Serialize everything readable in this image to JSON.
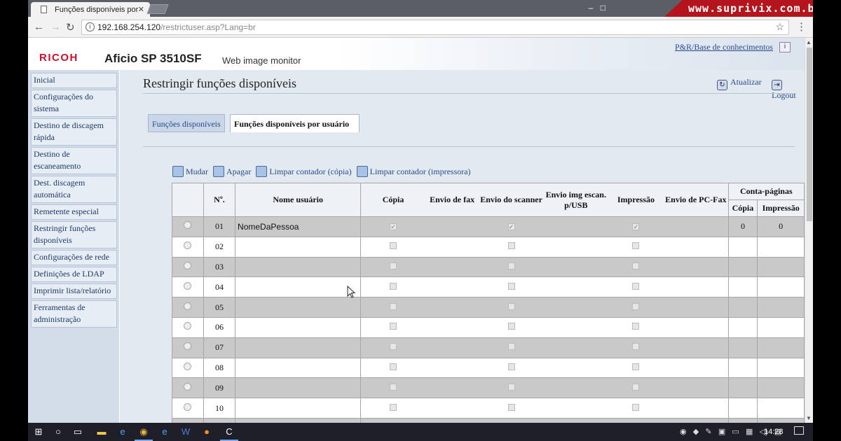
{
  "browser": {
    "tab_title": "Funções disponíveis por",
    "url_host": "192.168.254.120",
    "url_path": "/restrictuser.asp?Lang=br",
    "brand_overlay": "www.suprivix.com.br"
  },
  "header": {
    "logo": "RICOH",
    "model": "Aficio SP 3510SF",
    "subtitle": "Web image monitor",
    "kb_link": "P&R/Base de conhecimentos"
  },
  "sidebar": {
    "items": [
      {
        "label": "Inicial"
      },
      {
        "label": "Configurações do sistema"
      },
      {
        "label": "Destino de discagem rápida"
      },
      {
        "label": "Destino de escaneamento"
      },
      {
        "label": "Dest. discagem automática"
      },
      {
        "label": "Remetente especial"
      },
      {
        "label": "Restringir funções disponíveis"
      },
      {
        "label": "Configurações de rede"
      },
      {
        "label": "Definições de LDAP"
      },
      {
        "label": "Imprimir lista/relatório"
      },
      {
        "label": "Ferramentas de administração"
      }
    ]
  },
  "main": {
    "title": "Restringir funções disponíveis",
    "refresh_label": "Atualizar",
    "logout_label": "Logout",
    "tabs": [
      {
        "label": "Funções disponíveis"
      },
      {
        "label": "Funções disponíveis por usuário"
      }
    ],
    "actions": {
      "change": "Mudar",
      "delete": "Apagar",
      "clear_copy": "Limpar contador (cópia)",
      "clear_print": "Limpar contador (impressora)"
    }
  },
  "table": {
    "headers": {
      "number": "Nº.",
      "name": "Nome usuário",
      "copy": "Cópia",
      "fax": "Envio de fax",
      "scanner": "Envio do scanner",
      "scan_usb": "Envio img escan. p/USB",
      "print": "Impressão",
      "pcfax": "Envio de PC-Fax",
      "counter": "Conta-páginas",
      "counter_copy": "Cópia",
      "counter_print": "Impressão"
    },
    "rows": [
      {
        "num": "01",
        "name": "NomeDaPessoa",
        "copy": "✓",
        "scanner": "✓",
        "print": "✓",
        "c_copy": "0",
        "c_print": "0"
      },
      {
        "num": "02",
        "name": "",
        "copy": "",
        "scanner": "",
        "print": "",
        "c_copy": "",
        "c_print": ""
      },
      {
        "num": "03",
        "name": "",
        "copy": "",
        "scanner": "",
        "print": "",
        "c_copy": "",
        "c_print": ""
      },
      {
        "num": "04",
        "name": "",
        "copy": "",
        "scanner": "",
        "print": "",
        "c_copy": "",
        "c_print": ""
      },
      {
        "num": "05",
        "name": "",
        "copy": "",
        "scanner": "",
        "print": "",
        "c_copy": "",
        "c_print": ""
      },
      {
        "num": "06",
        "name": "",
        "copy": "",
        "scanner": "",
        "print": "",
        "c_copy": "",
        "c_print": ""
      },
      {
        "num": "07",
        "name": "",
        "copy": "",
        "scanner": "",
        "print": "",
        "c_copy": "",
        "c_print": ""
      },
      {
        "num": "08",
        "name": "",
        "copy": "",
        "scanner": "",
        "print": "",
        "c_copy": "",
        "c_print": ""
      },
      {
        "num": "09",
        "name": "",
        "copy": "",
        "scanner": "",
        "print": "",
        "c_copy": "",
        "c_print": ""
      },
      {
        "num": "10",
        "name": "",
        "copy": "",
        "scanner": "",
        "print": "",
        "c_copy": "",
        "c_print": ""
      }
    ]
  },
  "taskbar": {
    "clock": "14:28"
  },
  "colors": {
    "ricoh_red": "#c8102e",
    "link_blue": "#2a4a8a",
    "sidebar_bg": "#d3dde9",
    "main_bg": "#e3e9f1",
    "row_grey": "#c9c9c9",
    "brand_red": "#b4141b"
  }
}
